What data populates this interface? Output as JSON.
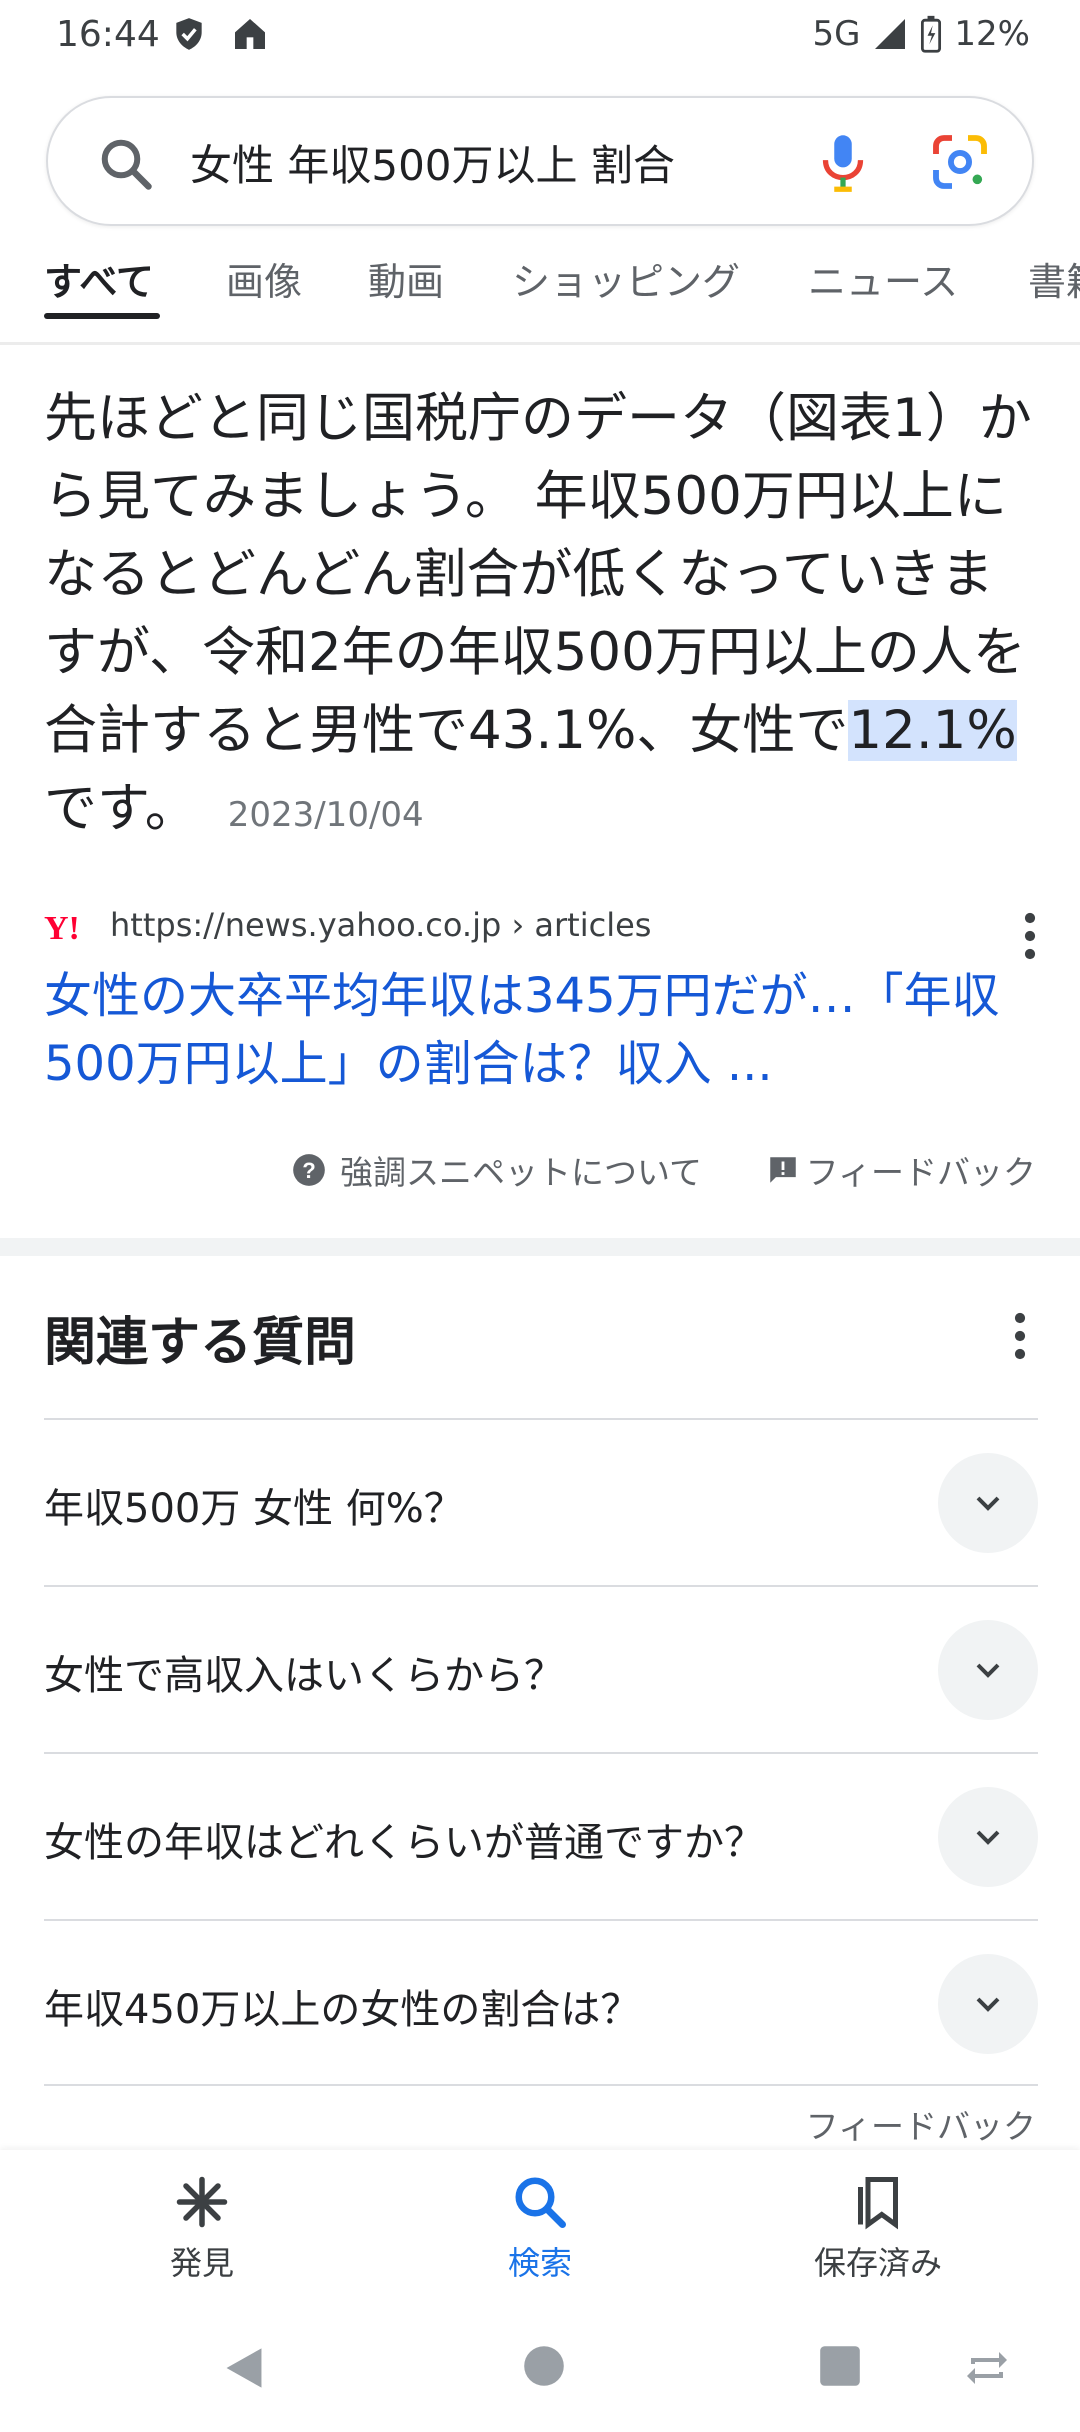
{
  "status_bar": {
    "time": "16:44",
    "network": "5G",
    "battery": "12%"
  },
  "search": {
    "query": "女性 年収500万以上 割合"
  },
  "tabs": [
    {
      "label": "すべて",
      "active": true
    },
    {
      "label": "画像"
    },
    {
      "label": "動画"
    },
    {
      "label": "ショッピング"
    },
    {
      "label": "ニュース"
    },
    {
      "label": "書籍"
    }
  ],
  "featured_snippet": {
    "text_before": "先ほどと同じ国税庁のデータ（図表1）から見てみましょう。 年収500万円以上になるとどんどん割合が低くなっていきますが、令和2年の年収500万円以上の人を合計すると男性で43.1%、女性で",
    "highlight": "12.1%",
    "text_after": "です。",
    "date": "2023/10/04",
    "source_url": "https://news.yahoo.co.jp › articles",
    "source_logo": "Y!",
    "title": "女性の大卒平均年収は345万円だが…「年収500万円以上」の割合は？収入 ...",
    "about_label": "強調スニペットについて",
    "feedback_label": "フィードバック"
  },
  "related_questions": {
    "title": "関連する質問",
    "items": [
      "年収500万 女性 何%？",
      "女性で高収入はいくらから？",
      "女性の年収はどれくらいが普通ですか？",
      "年収450万以上の女性の割合は？"
    ],
    "feedback_label": "フィードバック"
  },
  "bottom_nav": [
    {
      "label": "発見",
      "icon": "asterisk-icon"
    },
    {
      "label": "検索",
      "icon": "search-icon",
      "active": true
    },
    {
      "label": "保存済み",
      "icon": "bookmarks-icon"
    }
  ],
  "colors": {
    "accent": "#1a73e8",
    "link": "#1558d6",
    "highlight": "#d3e3fd"
  }
}
